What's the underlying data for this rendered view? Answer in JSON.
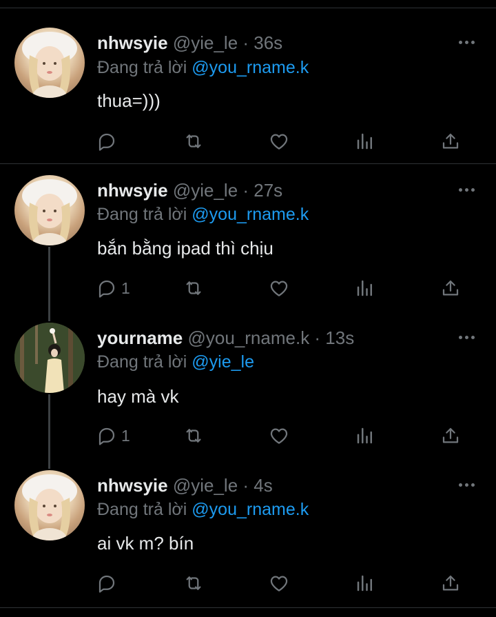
{
  "colors": {
    "background": "#000000",
    "text": "#e7e9ea",
    "muted": "#71767b",
    "accent": "#1d9bf0",
    "divider": "#2f3336"
  },
  "tweets": [
    {
      "name": "nhwsyie",
      "meta": "@yie_le · 36s",
      "reply_prefix": "Đang trả lời",
      "reply_to": "@you_rname.k",
      "text": "thua=)))",
      "reply_count": "",
      "avatar": "avatar-girl-white-hat"
    },
    {
      "name": "nhwsyie",
      "meta": "@yie_le · 27s",
      "reply_prefix": "Đang trả lời",
      "reply_to": "@you_rname.k",
      "text": "bắn bằng ipad thì chịu",
      "reply_count": "1",
      "avatar": "avatar-girl-white-hat"
    },
    {
      "name": "yourname",
      "meta": "@you_rname.k · 13s",
      "reply_prefix": "Đang trả lời",
      "reply_to": "@yie_le",
      "text": "hay mà vk",
      "reply_count": "1",
      "avatar": "avatar-girl-forest"
    },
    {
      "name": "nhwsyie",
      "meta": "@yie_le · 4s",
      "reply_prefix": "Đang trả lời",
      "reply_to": "@you_rname.k",
      "text": "ai vk m? bín",
      "reply_count": "",
      "avatar": "avatar-girl-white-hat"
    }
  ],
  "icons": {
    "reply": "reply-icon",
    "retweet": "retweet-icon",
    "like": "heart-icon",
    "views": "views-icon",
    "share": "share-icon",
    "more": "more-icon"
  }
}
